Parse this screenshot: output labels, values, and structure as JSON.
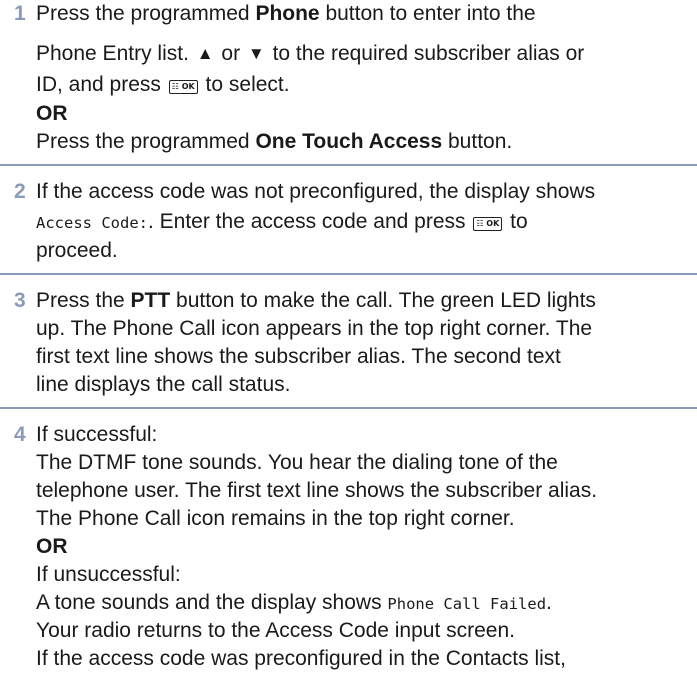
{
  "steps": [
    {
      "number": "1",
      "line1_pre": "Press the programmed ",
      "line1_bold": "Phone",
      "line1_post": " button to enter into the",
      "line2_pre": "Phone Entry list. ",
      "line2_mid": " or ",
      "line2_post": " to the required subscriber alias or",
      "line3_pre": "ID, and press ",
      "line3_post": " to select.",
      "or": "OR",
      "line5_pre": "Press the programmed ",
      "line5_bold": "One Touch Access",
      "line5_post": " button."
    },
    {
      "number": "2",
      "line1": "If the access code was not preconfigured, the display shows",
      "line2_mono": "Access Code:",
      "line2_mid": ". Enter the access code and press ",
      "line2_post": " to",
      "line3": "proceed."
    },
    {
      "number": "3",
      "line1_pre": "Press the ",
      "line1_bold": "PTT",
      "line1_post": " button to make the call. The green LED lights",
      "line2": "up. The Phone Call icon appears in the top right corner. The",
      "line3": "first text line shows the subscriber alias. The second text",
      "line4": "line displays the call status."
    },
    {
      "number": "4",
      "line1": "If successful:",
      "line2": "The DTMF tone sounds. You hear the dialing tone of the",
      "line3": "telephone user. The first text line shows the subscriber alias.",
      "line4": "The Phone Call icon remains in the top right corner.",
      "or": "OR",
      "line6": "If unsuccessful:",
      "line7_pre": "A tone sounds and the display shows ",
      "line7_mono": "Phone Call Failed",
      "line7_post": ".",
      "line8": "Your radio returns to the Access Code input screen.",
      "line9": "If the access code was preconfigured in the Contacts list,"
    }
  ],
  "key_label": "☷ OK",
  "icons": {
    "up": "up-arrow-icon",
    "down": "down-arrow-icon",
    "menu_ok": "menu-ok-key-icon"
  },
  "colors": {
    "step_number": "#8a9bb8",
    "divider": "#8a9bb8",
    "text": "#1a1a1a"
  }
}
